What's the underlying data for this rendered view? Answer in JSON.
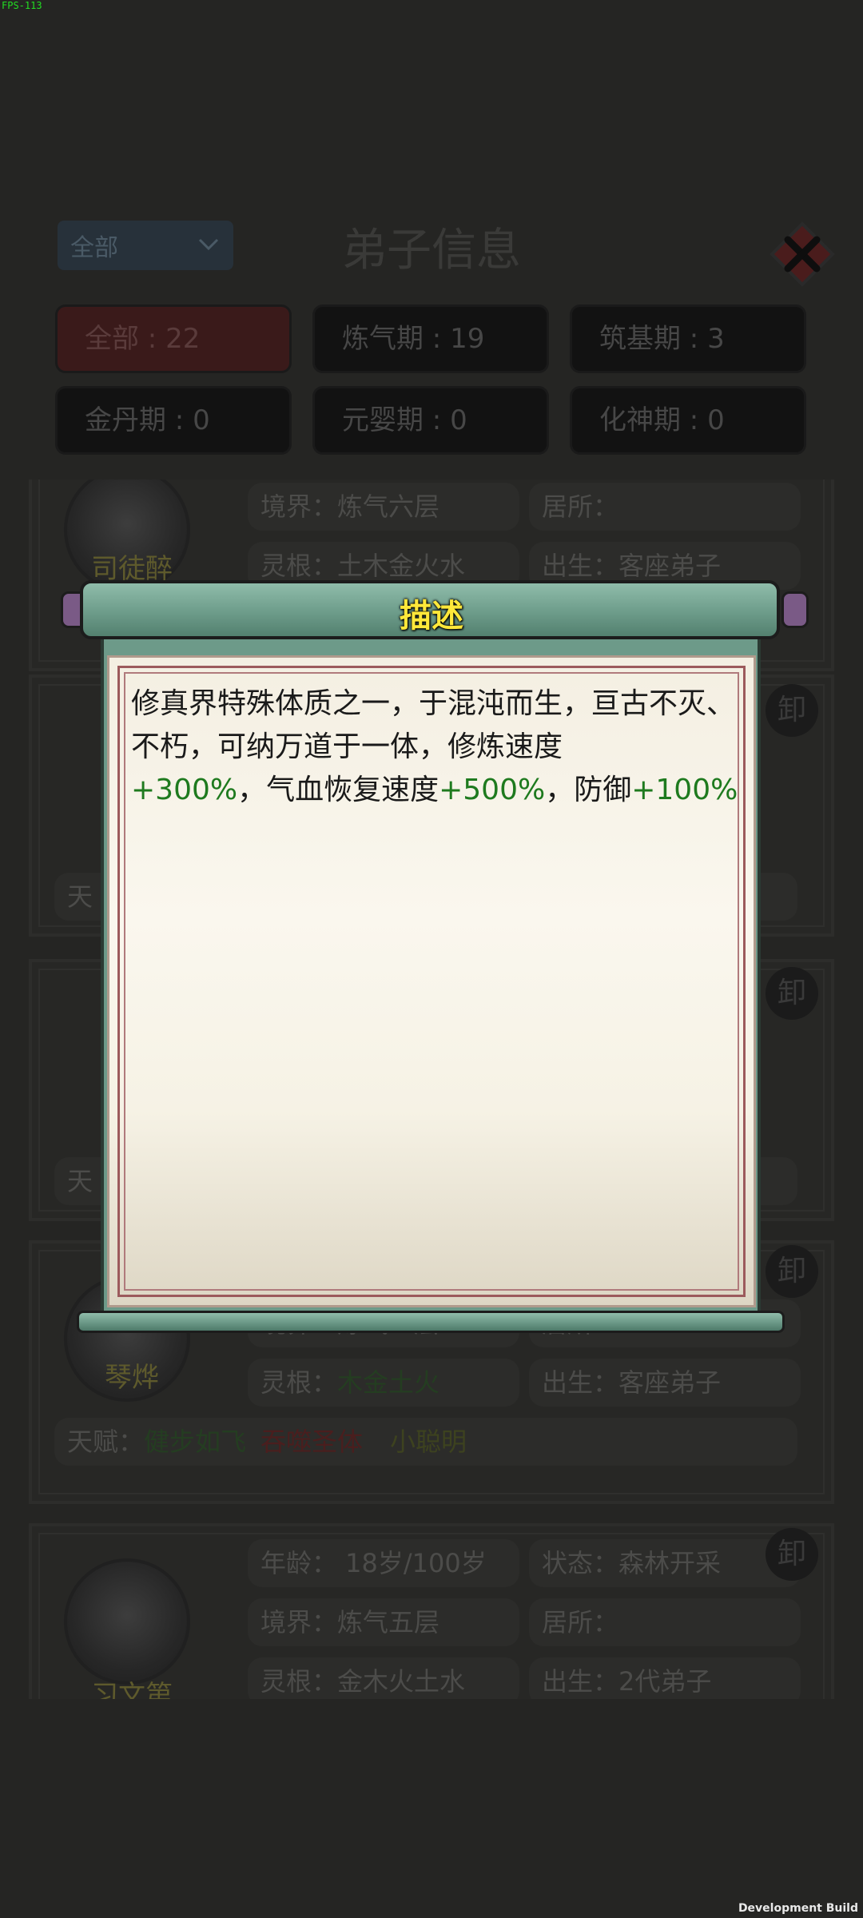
{
  "fps": "FPS-113",
  "dev_build": "Development Build",
  "header": {
    "title": "弟子信息",
    "dropdown_value": "全部"
  },
  "filters": [
    {
      "label": "全部 : 22"
    },
    {
      "label": "炼气期 : 19"
    },
    {
      "label": "筑基期 : 3"
    },
    {
      "label": "金丹期 : 0"
    },
    {
      "label": "元婴期 : 0"
    },
    {
      "label": "化神期 : 0"
    }
  ],
  "cards": {
    "c1": {
      "name": "司徒醉",
      "realm": "境界：炼气六层",
      "home": "居所：",
      "root": "灵根：土木金火水",
      "birth": "出生：客座弟子"
    },
    "c2": {
      "label_talent": "天"
    },
    "c3": {
      "label_talent": "天"
    },
    "c4": {
      "name": "琴烨",
      "realm": "境界：炼气五层",
      "home": "居所：",
      "root_label": "灵根：",
      "root_value": "木金土火",
      "birth": "出生：客座弟子",
      "talent_label": "天赋：",
      "talents": [
        "健步如飞",
        "吞噬圣体",
        "小聪明"
      ]
    },
    "c5": {
      "name": "习文第",
      "age": "年龄： 18岁/100岁",
      "status": "状态：森林开采",
      "realm": "境界：炼气五层",
      "home": "居所：",
      "root": "灵根：金木火土水",
      "birth": "出生：2代弟子"
    },
    "seal_char": "卸"
  },
  "modal": {
    "title": "描述",
    "desc_1": "修真界特殊体质之一，于混沌而生，亘古不灭、不朽，可纳万道于一体，修炼速度",
    "bonus_1": "+300%",
    "desc_2": "，气血恢复速度",
    "bonus_2": "+500%",
    "desc_3": "，防御",
    "bonus_3": "+100%"
  }
}
